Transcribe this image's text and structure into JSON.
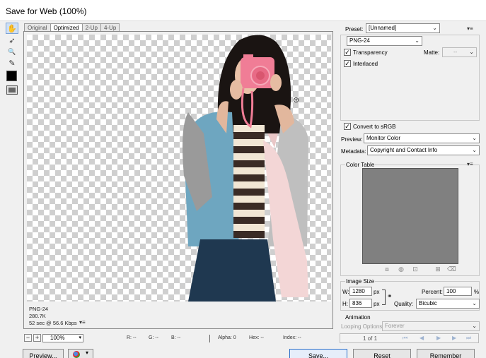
{
  "window": {
    "title": "Save for Web (100%)"
  },
  "toolbar": {
    "tools": [
      {
        "name": "hand-tool",
        "glyph": "✋"
      },
      {
        "name": "slice-select-tool",
        "glyph": "➶"
      },
      {
        "name": "zoom-tool",
        "glyph": "🔍"
      },
      {
        "name": "eyedropper-tool",
        "glyph": "✎"
      }
    ]
  },
  "view_tabs": [
    "Original",
    "Optimized",
    "2-Up",
    "4-Up"
  ],
  "image_info": {
    "format": "PNG-24",
    "size": "280.7K",
    "download_time": "52 sec @ 56.6 Kbps",
    "menu_glyph": "▾≡"
  },
  "status": {
    "zoom": "100%",
    "r": "R: --",
    "g": "G: --",
    "b": "B: --",
    "alpha": "Alpha: 0",
    "hex": "Hex: --",
    "index": "Index: --"
  },
  "bottom_buttons": {
    "preview": "Preview...",
    "save": "Save...",
    "reset": "Reset",
    "remember": "Remember"
  },
  "settings": {
    "preset_label": "Preset:",
    "preset_value": "[Unnamed]",
    "format_value": "PNG-24",
    "transparency_label": "Transparency",
    "transparency_checked": true,
    "interlaced_label": "Interlaced",
    "interlaced_checked": true,
    "matte_label": "Matte:",
    "matte_value": "--",
    "convert_srgb_label": "Convert to sRGB",
    "convert_srgb_checked": true,
    "preview_label": "Preview:",
    "preview_value": "Monitor Color",
    "metadata_label": "Metadata:",
    "metadata_value": "Copyright and Contact Info"
  },
  "color_table": {
    "title": "Color Table",
    "swatch_color": "#808080"
  },
  "image_size": {
    "title": "Image Size",
    "w_label": "W:",
    "width": "1280",
    "h_label": "H:",
    "height": "836",
    "unit": "px",
    "percent_label": "Percent:",
    "percent": "100",
    "percent_unit": "%",
    "quality_label": "Quality:",
    "quality": "Bicubic"
  },
  "animation": {
    "title": "Animation",
    "looping_label": "Looping Options:",
    "looping_value": "Forever",
    "frame_counter": "1 of 1"
  },
  "colors": {
    "accent": "#2a6fc9",
    "canvas_check": "#cfcfcf"
  }
}
